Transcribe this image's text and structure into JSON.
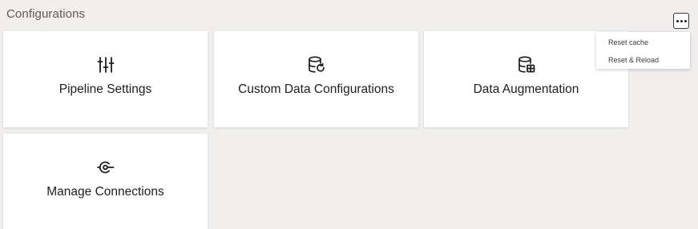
{
  "page": {
    "title": "Configurations"
  },
  "overflow_menu": {
    "button_icon": "more-horizontal-icon",
    "items": [
      {
        "label": "Reset cache"
      },
      {
        "label": "Reset & Reload"
      }
    ]
  },
  "tiles": [
    {
      "label": "Pipeline Settings",
      "icon": "sliders-icon"
    },
    {
      "label": "Custom Data Configurations",
      "icon": "database-refresh-icon"
    },
    {
      "label": "Data Augmentation",
      "icon": "database-table-icon"
    },
    {
      "label": "Manage Connections",
      "icon": "connection-icon"
    }
  ]
}
